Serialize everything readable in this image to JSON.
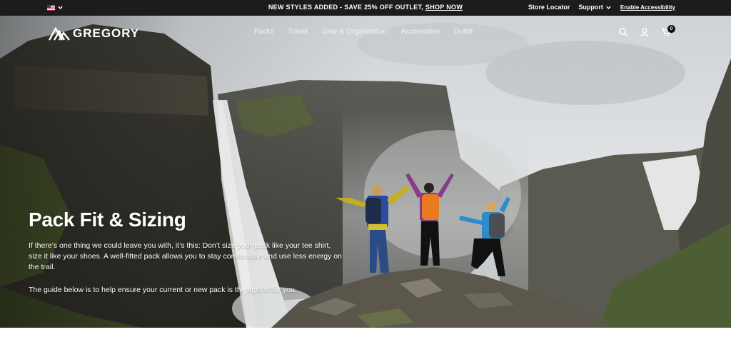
{
  "announcement": {
    "promo_text": "NEW STYLES ADDED - SAVE 25% OFF OUTLET, ",
    "promo_link": "SHOP NOW",
    "store_locator": "Store Locator",
    "support": "Support",
    "accessibility": "Enable Accessibility"
  },
  "header": {
    "logo_text": "GREGORY",
    "nav": [
      "Packs",
      "Travel",
      "Gear & Organization",
      "Accessories",
      "Outlet"
    ],
    "cart_count": "0",
    "icons": [
      "search-icon",
      "account-icon",
      "cart-icon"
    ]
  },
  "hero": {
    "title": "Pack Fit & Sizing",
    "paragraph1": "If there’s one thing we could leave you with, it’s this: Don’t size your pack like your tee shirt, size it like your shoes. A well-fitted pack allows you to stay comfortable and use less energy on the trail.",
    "paragraph2": "The guide below is to help ensure your current or new pack is the right fit for you."
  },
  "colors": {
    "topbar_bg": "#1c1c1c",
    "text_on_hero": "#ffffff"
  }
}
